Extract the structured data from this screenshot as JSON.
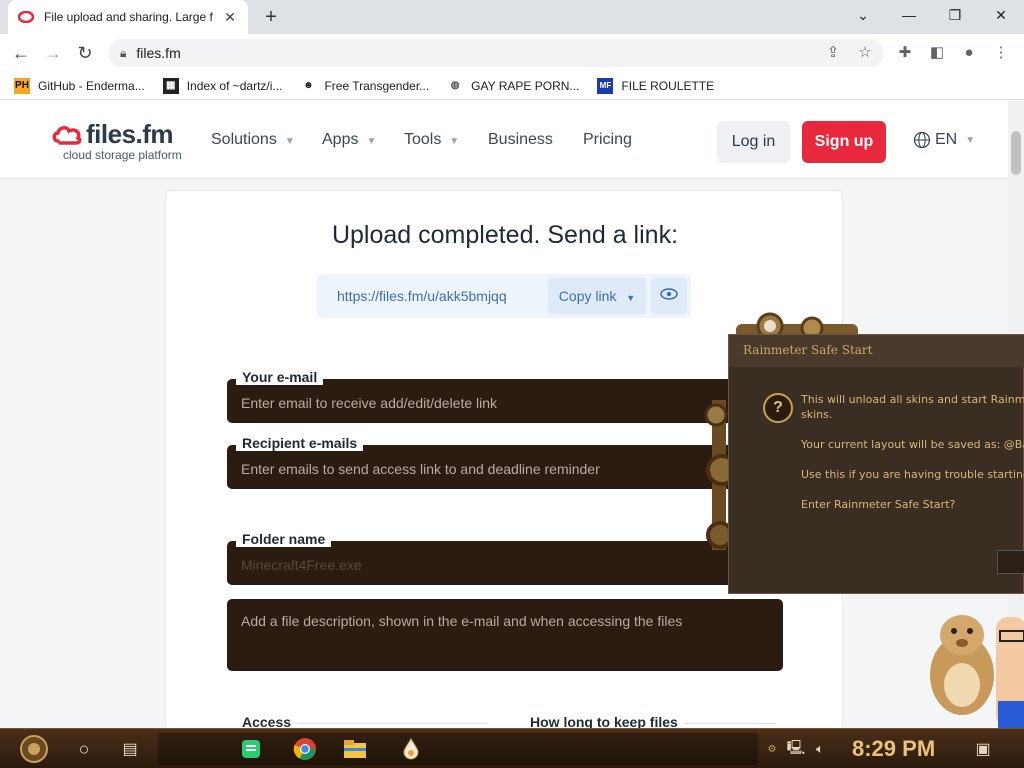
{
  "browser": {
    "tab_title": "File upload and sharing. Large f",
    "url": "files.fm",
    "bookmarks": [
      {
        "label": "GitHub - Enderma...",
        "icon": "PH"
      },
      {
        "label": "Index of ~dartz/i...",
        "icon": "index-icon"
      },
      {
        "label": "Free Transgender...",
        "icon": "mask-icon"
      },
      {
        "label": "GAY RAPE PORN...",
        "icon": "globe-icon"
      },
      {
        "label": "FILE ROULETTE",
        "icon": "MF"
      }
    ]
  },
  "site": {
    "logo_name": "files.fm",
    "logo_tag": "cloud storage platform",
    "nav": [
      "Solutions",
      "Apps",
      "Tools",
      "Business",
      "Pricing"
    ],
    "login": "Log in",
    "signup": "Sign up",
    "lang": "EN"
  },
  "upload": {
    "title": "Upload completed. Send a link:",
    "link": "https://files.fm/u/akk5bmjqq",
    "copy_label": "Copy link",
    "email_label": "Your e-mail",
    "email_placeholder": "Enter email to receive add/edit/delete link",
    "recipients_label": "Recipient e-mails",
    "recipients_placeholder": "Enter emails to send access link to and deadline reminder",
    "folder_label": "Folder name",
    "folder_value": "Minecraft4Free.exe",
    "description_placeholder": "Add a file description, shown in the e-mail and when accessing the files",
    "access_label": "Access",
    "keep_label": "How long to keep files"
  },
  "rainmeter": {
    "title": "Rainmeter Safe Start",
    "lines": [
      "This will unload all skins and start Rainmeter",
      "skins.",
      "Your current layout will be saved as: @Back",
      "Use this if you are having trouble starting R",
      "Enter Rainmeter Safe Start?"
    ]
  },
  "taskbar": {
    "clock": "8:29 PM"
  },
  "colors": {
    "accent_red": "#e8283c",
    "link_blue": "#3b6fb0",
    "field_dark": "#2b1c12"
  }
}
